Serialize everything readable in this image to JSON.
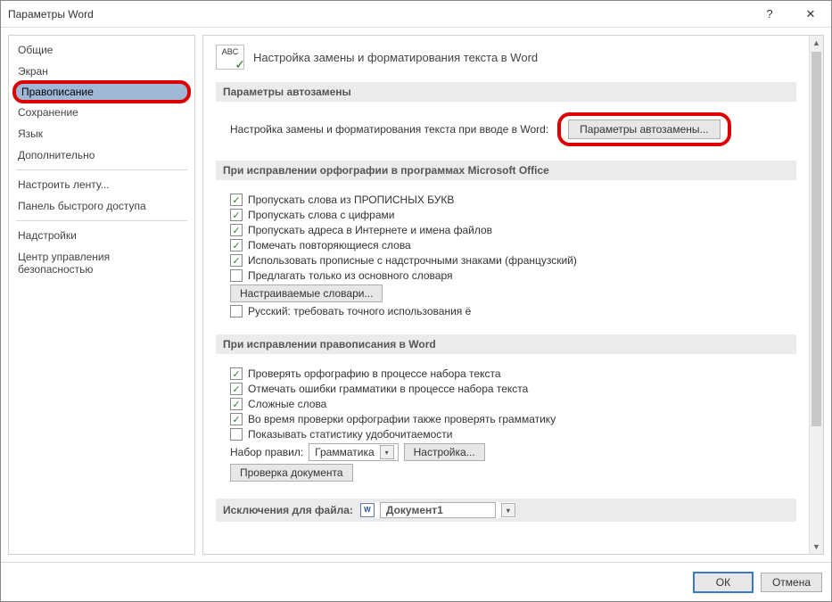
{
  "title": "Параметры Word",
  "titlebar": {
    "help": "?",
    "close": "✕"
  },
  "sidebar": {
    "items": [
      {
        "label": "Общие"
      },
      {
        "label": "Экран"
      },
      {
        "label": "Правописание",
        "selected": true,
        "highlighted": true
      },
      {
        "label": "Сохранение"
      },
      {
        "label": "Язык"
      },
      {
        "label": "Дополнительно"
      },
      {
        "label": "Настроить ленту..."
      },
      {
        "label": "Панель быстрого доступа"
      },
      {
        "label": "Надстройки"
      },
      {
        "label": "Центр управления безопасностью"
      }
    ],
    "dividers_after": [
      5,
      7
    ]
  },
  "header": {
    "icon_text": "ABC",
    "title": "Настройка замены и форматирования текста в Word"
  },
  "sections": {
    "autocorrect": {
      "header": "Параметры автозамены",
      "text": "Настройка замены и форматирования текста при вводе в Word:",
      "button": "Параметры автозамены..."
    },
    "office_spelling": {
      "header": "При исправлении орфографии в программах Microsoft Office",
      "checks": [
        {
          "label": "Пропускать слова из ПРОПИСНЫХ БУКВ",
          "checked": true
        },
        {
          "label": "Пропускать слова с цифрами",
          "checked": true
        },
        {
          "label": "Пропускать адреса в Интернете и имена файлов",
          "checked": true
        },
        {
          "label": "Помечать повторяющиеся слова",
          "checked": true
        },
        {
          "label": "Использовать прописные с надстрочными знаками (французский)",
          "checked": true
        },
        {
          "label": "Предлагать только из основного словаря",
          "checked": false
        }
      ],
      "dict_button": "Настраиваемые словари...",
      "ru_yo": {
        "label": "Русский: требовать точного использования ё",
        "checked": false
      }
    },
    "word_spelling": {
      "header": "При исправлении правописания в Word",
      "checks": [
        {
          "label": "Проверять орфографию в процессе набора текста",
          "checked": true
        },
        {
          "label": "Отмечать ошибки грамматики в процессе набора текста",
          "checked": true
        },
        {
          "label": "Сложные слова",
          "checked": true
        },
        {
          "label": "Во время проверки орфографии также проверять грамматику",
          "checked": true
        },
        {
          "label": "Показывать статистику удобочитаемости",
          "checked": false
        }
      ],
      "ruleset_label": "Набор правил:",
      "ruleset_value": "Грамматика",
      "settings_button": "Настройка...",
      "check_doc_button": "Проверка документа"
    },
    "exceptions": {
      "header": "Исключения для файла:",
      "doc_value": "Документ1"
    }
  },
  "footer": {
    "ok": "ОК",
    "cancel": "Отмена"
  }
}
